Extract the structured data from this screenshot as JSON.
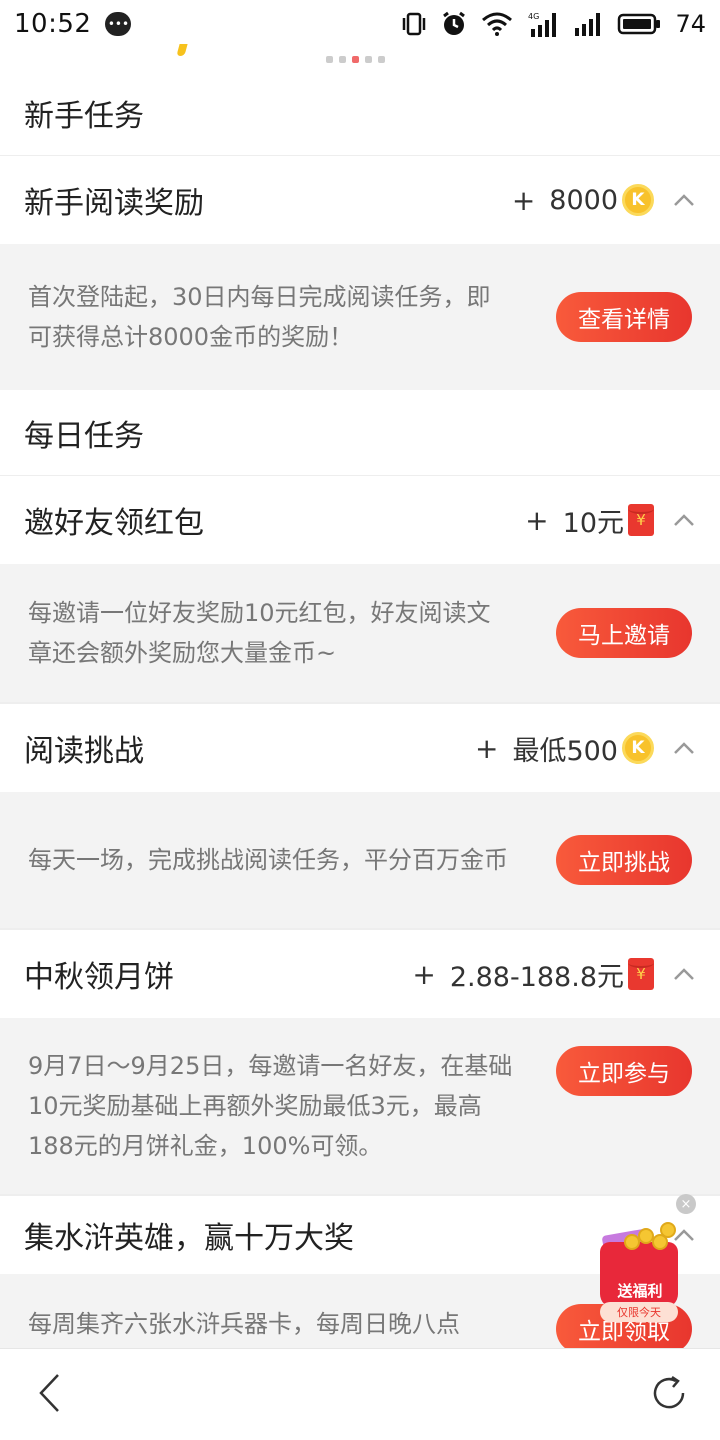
{
  "status_bar": {
    "time": "10:52",
    "network": "4G",
    "battery": "74",
    "icons": [
      "message-icon",
      "vibrate-icon",
      "alarm-icon",
      "wifi-icon",
      "signal-icon",
      "signal-icon",
      "battery-icon"
    ]
  },
  "carousel": {
    "pages": 5,
    "active_index": 3
  },
  "sections": {
    "newbie": {
      "title": "新手任务"
    },
    "daily": {
      "title": "每日任务"
    }
  },
  "tasks": [
    {
      "name": "新手阅读奖励",
      "plus": "+",
      "reward": "8000",
      "reward_icon": "coin-icon",
      "coin_glyph": "K",
      "desc": "首次登陆起，30日内每日完成阅读任务，即可获得总计8000金币的奖励！",
      "button": "查看详情"
    },
    {
      "name": "邀好友领红包",
      "plus": "+",
      "reward": "10元",
      "reward_icon": "red-envelope-icon",
      "envelope_glyph": "¥",
      "desc": "每邀请一位好友奖励10元红包，好友阅读文章还会额外奖励您大量金币~",
      "button": "马上邀请"
    },
    {
      "name": "阅读挑战",
      "plus": "+",
      "reward": "最低500",
      "reward_icon": "coin-icon",
      "coin_glyph": "K",
      "desc": "每天一场，完成挑战阅读任务，平分百万金币",
      "button": "立即挑战"
    },
    {
      "name": "中秋领月饼",
      "plus": "+",
      "reward": "2.88-188.8元",
      "reward_icon": "red-envelope-icon",
      "envelope_glyph": "¥",
      "desc": "9月7日～9月25日，每邀请一名好友，在基础10元奖励基础上再额外奖励最低3元，最高188元的月饼礼金，100%可领。",
      "button": "立即参与"
    },
    {
      "name": "集水浒英雄，赢十万大奖",
      "desc": "每周集齐六张水浒兵器卡，每周日晚八点",
      "button": "立即领取"
    }
  ],
  "promo": {
    "label": "送福利",
    "sub": "仅限今天",
    "close": "×"
  },
  "colors": {
    "accent": "#e8362e",
    "coin": "#f8c22b",
    "desc_bg": "#f3f3f3"
  }
}
